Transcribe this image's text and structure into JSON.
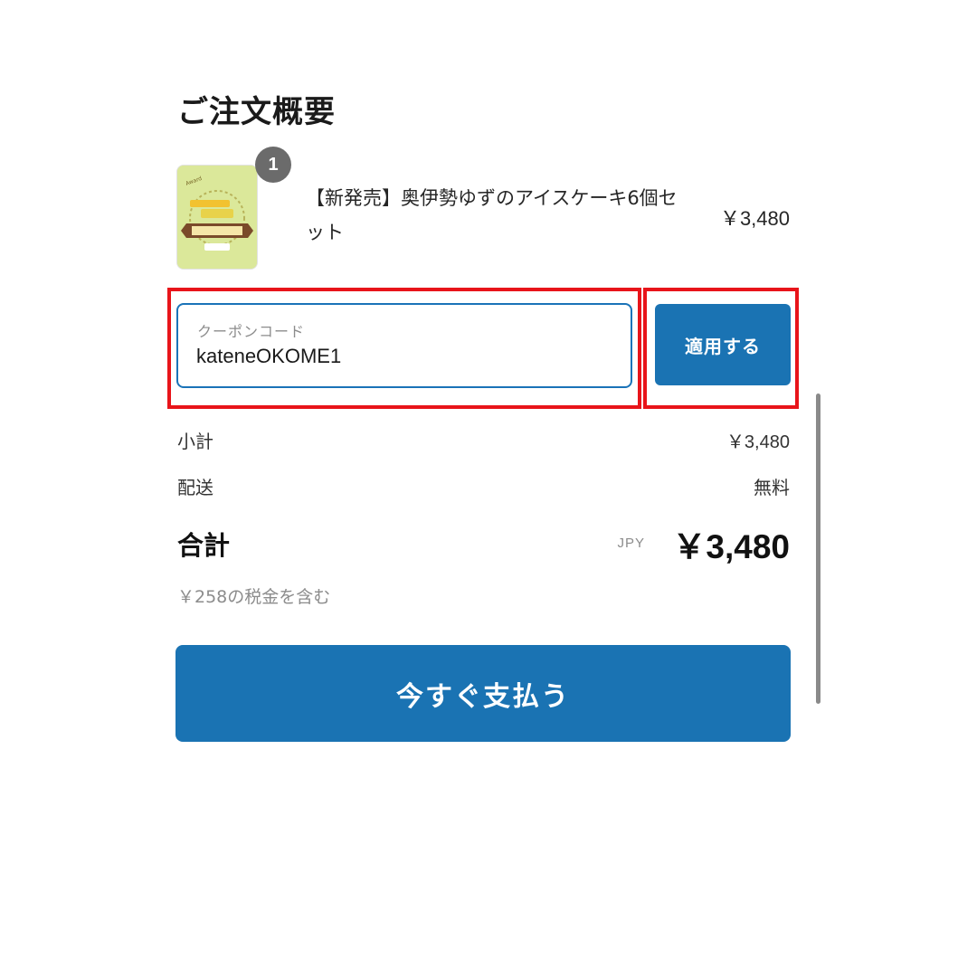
{
  "summary": {
    "title": "ご注文概要"
  },
  "product": {
    "quantity": "1",
    "name": "【新発売】奥伊勢ゆずのアイスケーキ6個セット",
    "price": "￥3,480",
    "thumb_color": "#dbe89a"
  },
  "coupon": {
    "label": "クーポンコード",
    "value": "kateneOKOME1",
    "apply_label": "適用する"
  },
  "totals": {
    "subtotal_label": "小計",
    "subtotal_value": "￥3,480",
    "shipping_label": "配送",
    "shipping_value": "無料",
    "total_label": "合計",
    "currency": "JPY",
    "total_value": "￥3,480",
    "tax_note": "￥258の税金を含む"
  },
  "actions": {
    "pay_label": "今すぐ支払う"
  },
  "colors": {
    "accent": "#1a73b3",
    "highlight": "#e8141a"
  }
}
